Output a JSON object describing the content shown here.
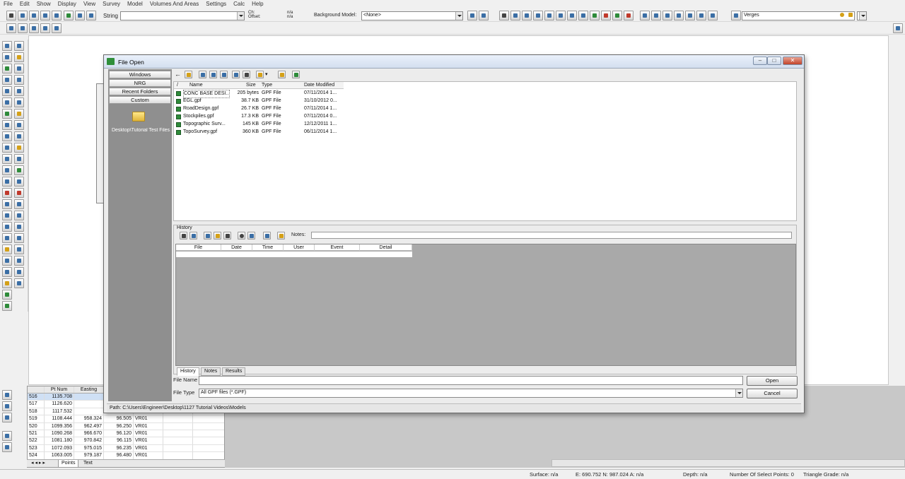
{
  "menu": [
    "File",
    "Edit",
    "Show",
    "Display",
    "View",
    "Survey",
    "Model",
    "Volumes And Areas",
    "Settings",
    "Calc",
    "Help"
  ],
  "toolbar": {
    "string_label": "String",
    "string_value": "",
    "ch_offset_label_1": "Ch:",
    "ch_offset_label_2": "Offset:",
    "ch_value": "n/a",
    "offset_value": "n/a",
    "background_model_label": "Background Model:",
    "background_model_value": "<None>",
    "layer_value": "Verges"
  },
  "dialog": {
    "title": "File Open",
    "sidebar": {
      "buttons": [
        "Windows",
        "NRG",
        "Recent Folders",
        "Custom"
      ],
      "folder_label": "Desktop\\Tutorial Test Files"
    },
    "file_list": {
      "columns": [
        "Name",
        "Size",
        "Type",
        "Date Modified"
      ],
      "files": [
        {
          "name": "CONC BASE DESI...",
          "size": "205 bytes",
          "type": "GPF File",
          "date": "07/11/2014 1..."
        },
        {
          "name": "EGL.gpf",
          "size": "38.7 KB",
          "type": "GPF File",
          "date": "31/10/2012 0..."
        },
        {
          "name": "RoadDesign.gpf",
          "size": "26.7 KB",
          "type": "GPF File",
          "date": "07/11/2014 1..."
        },
        {
          "name": "Stockpiles.gpf",
          "size": "17.3 KB",
          "type": "GPF File",
          "date": "07/11/2014 0..."
        },
        {
          "name": "Topographic Surv...",
          "size": "145 KB",
          "type": "GPF File",
          "date": "12/12/2011 1..."
        },
        {
          "name": "TopoSurvey.gpf",
          "size": "360 KB",
          "type": "GPF File",
          "date": "06/11/2014 1..."
        }
      ]
    },
    "history": {
      "label": "History",
      "notes_label": "Notes:",
      "columns": [
        "File",
        "Date",
        "Time",
        "User",
        "Event",
        "Detail"
      ],
      "tabs": [
        "History",
        "Notes",
        "Results"
      ]
    },
    "file_name_label": "File Name",
    "file_name_value": "",
    "file_type_label": "File Type",
    "file_type_value": "All GPF files (*.GPF)",
    "open_button": "Open",
    "cancel_button": "Cancel",
    "path": "Path: C:\\Users\\Engineer\\Desktop\\1127 Tutorial Videos\\Models"
  },
  "points_table": {
    "columns": [
      "",
      "Pt Num",
      "Easting"
    ],
    "rows": [
      [
        "516",
        "1135.708",
        "",
        "",
        ""
      ],
      [
        "517",
        "1126.620",
        "",
        "",
        ""
      ],
      [
        "518",
        "1117.532",
        "",
        "",
        ""
      ],
      [
        "519",
        "1108.444",
        "958.324",
        "96.505",
        "VR01"
      ],
      [
        "520",
        "1099.356",
        "962.497",
        "96.250",
        "VR01"
      ],
      [
        "521",
        "1090.268",
        "966.670",
        "96.120",
        "VR01"
      ],
      [
        "522",
        "1081.180",
        "970.842",
        "96.115",
        "VR01"
      ],
      [
        "523",
        "1072.093",
        "975.015",
        "96.235",
        "VR01"
      ],
      [
        "524",
        "1063.005",
        "979.187",
        "96.480",
        "VR01"
      ]
    ],
    "tabs": [
      "Points",
      "Text"
    ]
  },
  "status": {
    "surface": "Surface: n/a",
    "coords": "E: 690.752  N: 987.024  A: n/a",
    "depth": "Depth: n/a",
    "select_points": "Number Of Select Points: 0",
    "triangle_grade": "Triangle Grade: n/a"
  }
}
